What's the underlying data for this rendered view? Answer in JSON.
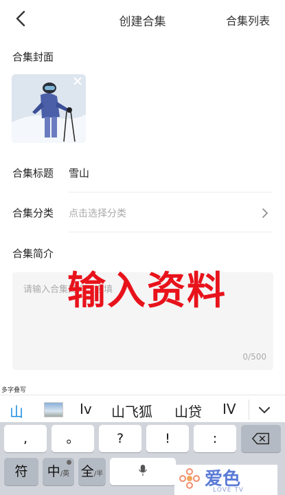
{
  "header": {
    "back_icon": "chevron-left-icon",
    "title": "创建合集",
    "list_link": "合集列表"
  },
  "cover": {
    "label": "合集封面",
    "close_icon": "close-icon"
  },
  "form": {
    "title_label": "合集标题",
    "title_value": "雪山",
    "category_label": "合集分类",
    "category_placeholder": "点击选择分类",
    "category_icon": "chevron-right-icon",
    "intro_label": "合集简介",
    "intro_placeholder": "请输入合集简介，选填",
    "intro_count": "0/500"
  },
  "watermark": "输入资料",
  "keyboard": {
    "caption": "多字叠写",
    "candidates": [
      "山",
      "Iv",
      "山飞狐",
      "山贷",
      "IV"
    ],
    "collapse_icon": "chevron-down-icon",
    "row1": [
      ",",
      "。",
      "?",
      "!",
      ":"
    ],
    "delete_icon": "backspace-icon",
    "fu": "符",
    "zh": "中",
    "zh_sub": "/英",
    "quan": "全",
    "quan_sub": "/半",
    "mic_icon": "microphone-icon"
  },
  "brand": {
    "name": "爱色",
    "sub": "LOVE TV"
  }
}
